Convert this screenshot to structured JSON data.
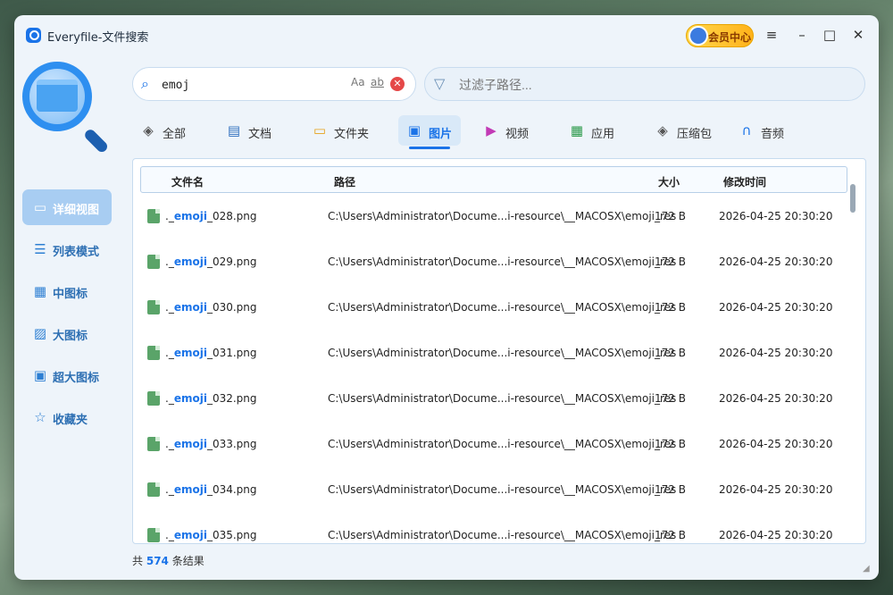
{
  "window": {
    "title": "Everyfile-文件搜索",
    "vip_label": "会员中心",
    "controls": {
      "menu": "≡",
      "minimize": "–",
      "maximize": "□",
      "close": "✕"
    }
  },
  "search": {
    "query": "emoj",
    "case_option": "Aa",
    "word_option": "ab",
    "clear": "✕",
    "filter_placeholder": "过滤子路径..."
  },
  "categories": [
    {
      "label": "全部",
      "icon": "layers-icon",
      "glyph": "◈",
      "color": "#555555"
    },
    {
      "label": "文档",
      "icon": "document-icon",
      "glyph": "▤",
      "color": "#2f6fbf"
    },
    {
      "label": "文件夹",
      "icon": "folder-icon",
      "glyph": "▭",
      "color": "#e6a21b"
    },
    {
      "label": "图片",
      "icon": "image-icon",
      "glyph": "▣",
      "color": "#1a73e8"
    },
    {
      "label": "视频",
      "icon": "video-icon",
      "glyph": "▶",
      "color": "#c23ab5"
    },
    {
      "label": "应用",
      "icon": "apps-icon",
      "glyph": "▦",
      "color": "#2c9a4a"
    },
    {
      "label": "压缩包",
      "icon": "archive-icon",
      "glyph": "◈",
      "color": "#555555"
    },
    {
      "label": "音频",
      "icon": "headphones-icon",
      "glyph": "∩",
      "color": "#1a73e8"
    }
  ],
  "active_category": "图片",
  "sidebar": {
    "items": [
      {
        "label": "详细视图",
        "icon": "detail-view-icon",
        "glyph": "▭"
      },
      {
        "label": "列表模式",
        "icon": "list-icon",
        "glyph": "☰"
      },
      {
        "label": "中图标",
        "icon": "medium-icons-icon",
        "glyph": "▦"
      },
      {
        "label": "大图标",
        "icon": "large-icons-icon",
        "glyph": "▨"
      },
      {
        "label": "超大图标",
        "icon": "extra-large-icons-icon",
        "glyph": "▣"
      },
      {
        "label": "收藏夹",
        "icon": "star-icon",
        "glyph": "☆"
      }
    ]
  },
  "table": {
    "headers": {
      "name": "文件名",
      "path": "路径",
      "size": "大小",
      "modified": "修改时间"
    },
    "rows": [
      {
        "prefix": "._",
        "match": "emoji",
        "suffix": "_028.png",
        "path": "C:\\Users\\Administrator\\Docume...i-resource\\__MACOSX\\emoji_res",
        "size": "172 B",
        "modified": "2026-04-25 20:30:20"
      },
      {
        "prefix": "._",
        "match": "emoji",
        "suffix": "_029.png",
        "path": "C:\\Users\\Administrator\\Docume...i-resource\\__MACOSX\\emoji_res",
        "size": "172 B",
        "modified": "2026-04-25 20:30:20"
      },
      {
        "prefix": "._",
        "match": "emoji",
        "suffix": "_030.png",
        "path": "C:\\Users\\Administrator\\Docume...i-resource\\__MACOSX\\emoji_res",
        "size": "172 B",
        "modified": "2026-04-25 20:30:20"
      },
      {
        "prefix": "._",
        "match": "emoji",
        "suffix": "_031.png",
        "path": "C:\\Users\\Administrator\\Docume...i-resource\\__MACOSX\\emoji_res",
        "size": "172 B",
        "modified": "2026-04-25 20:30:20"
      },
      {
        "prefix": "._",
        "match": "emoji",
        "suffix": "_032.png",
        "path": "C:\\Users\\Administrator\\Docume...i-resource\\__MACOSX\\emoji_res",
        "size": "172 B",
        "modified": "2026-04-25 20:30:20"
      },
      {
        "prefix": "._",
        "match": "emoji",
        "suffix": "_033.png",
        "path": "C:\\Users\\Administrator\\Docume...i-resource\\__MACOSX\\emoji_res",
        "size": "172 B",
        "modified": "2026-04-25 20:30:20"
      },
      {
        "prefix": "._",
        "match": "emoji",
        "suffix": "_034.png",
        "path": "C:\\Users\\Administrator\\Docume...i-resource\\__MACOSX\\emoji_res",
        "size": "172 B",
        "modified": "2026-04-25 20:30:20"
      },
      {
        "prefix": "._",
        "match": "emoji",
        "suffix": "_035.png",
        "path": "C:\\Users\\Administrator\\Docume...i-resource\\__MACOSX\\emoji_res",
        "size": "172 B",
        "modified": "2026-04-25 20:30:20"
      }
    ]
  },
  "status": {
    "prefix": "共",
    "count": "574",
    "suffix": "条结果"
  }
}
